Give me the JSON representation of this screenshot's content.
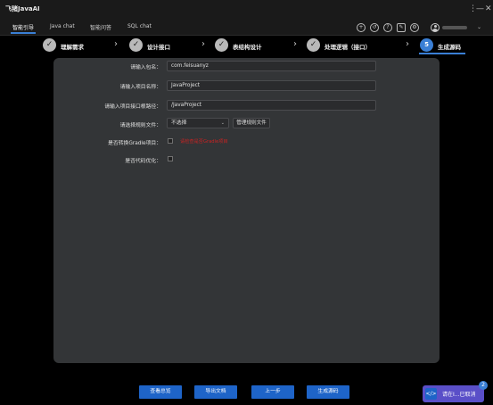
{
  "app": {
    "title": "飞猪JavaAI"
  },
  "window_controls": {
    "more": "⋮",
    "minimize": "—",
    "close": "✕"
  },
  "menu_tabs": [
    {
      "label": "智能引导",
      "active": true
    },
    {
      "label": "Java chat",
      "active": false
    },
    {
      "label": "智能问答",
      "active": false
    },
    {
      "label": "SQL chat",
      "active": false
    }
  ],
  "toolbar": {
    "icons": [
      "add-circle-icon",
      "history-icon",
      "help-icon",
      "edit-icon",
      "settings-icon",
      "user-avatar-icon"
    ],
    "user_chevron": "⌄"
  },
  "steps": [
    {
      "label": "理解需求",
      "status": "done",
      "mark": "✓"
    },
    {
      "label": "设计接口",
      "status": "done",
      "mark": "✓"
    },
    {
      "label": "表结构设计",
      "status": "done",
      "mark": "✓"
    },
    {
      "label": "处理逻辑（接口）",
      "status": "done",
      "mark": "✓"
    },
    {
      "label": "生成源码",
      "status": "current",
      "mark": "5"
    }
  ],
  "step_separator": "›",
  "form": {
    "package_label": "请输入包名：",
    "package_value": "com.feisuanyz",
    "project_name_label": "请输入项目名称：",
    "project_name_value": "JavaProject",
    "project_path_label": "请输入项目接口根路径：",
    "project_path_value": "/JavaProject",
    "rule_file_label": "请选择规则文件：",
    "rule_file_value": "不选择",
    "rule_file_arrow": "⌄",
    "manage_rules_button": "管理规则文件",
    "gradle_label": "是否转换Gradle项目：",
    "gradle_warning": "请检查是否Gradle项目",
    "optimize_label": "是否代码优化："
  },
  "bottom_buttons": {
    "summary": "查看总览",
    "export": "导出文档",
    "prev": "上一步",
    "generate": "生成源码"
  },
  "status_badge": {
    "text": "请在I...已取消",
    "count": "2",
    "icon": "</>"
  },
  "colors": {
    "accent": "#3a7fd5",
    "button_blue": "#1e64c8",
    "panel_bg": "#333537",
    "warning_red": "#cc2222",
    "badge_purple": "#5a4fc8"
  }
}
